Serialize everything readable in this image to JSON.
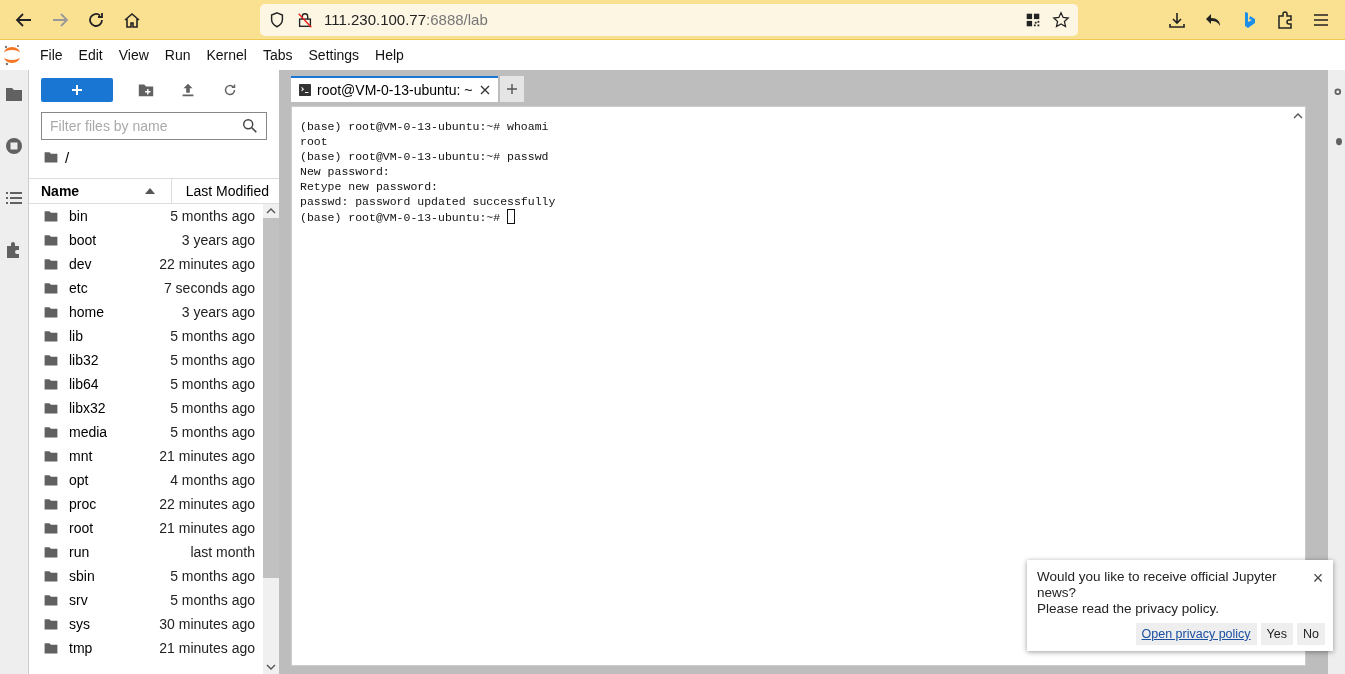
{
  "browser": {
    "url_host": "111.230.100.77",
    "url_path": ":6888/lab"
  },
  "menu": [
    "File",
    "Edit",
    "View",
    "Run",
    "Kernel",
    "Tabs",
    "Settings",
    "Help"
  ],
  "file_browser": {
    "filter_placeholder": "Filter files by name",
    "path": "/",
    "columns": [
      "Name",
      "Last Modified"
    ],
    "files": [
      {
        "name": "bin",
        "modified": "5 months ago"
      },
      {
        "name": "boot",
        "modified": "3 years ago"
      },
      {
        "name": "dev",
        "modified": "22 minutes ago"
      },
      {
        "name": "etc",
        "modified": "7 seconds ago"
      },
      {
        "name": "home",
        "modified": "3 years ago"
      },
      {
        "name": "lib",
        "modified": "5 months ago"
      },
      {
        "name": "lib32",
        "modified": "5 months ago"
      },
      {
        "name": "lib64",
        "modified": "5 months ago"
      },
      {
        "name": "libx32",
        "modified": "5 months ago"
      },
      {
        "name": "media",
        "modified": "5 months ago"
      },
      {
        "name": "mnt",
        "modified": "21 minutes ago"
      },
      {
        "name": "opt",
        "modified": "4 months ago"
      },
      {
        "name": "proc",
        "modified": "22 minutes ago"
      },
      {
        "name": "root",
        "modified": "21 minutes ago"
      },
      {
        "name": "run",
        "modified": "last month"
      },
      {
        "name": "sbin",
        "modified": "5 months ago"
      },
      {
        "name": "srv",
        "modified": "5 months ago"
      },
      {
        "name": "sys",
        "modified": "30 minutes ago"
      },
      {
        "name": "tmp",
        "modified": "21 minutes ago"
      }
    ]
  },
  "tabs": [
    {
      "label": "root@VM-0-13-ubuntu: ~",
      "selected": true
    }
  ],
  "terminal": {
    "cursor": true,
    "lines": [
      "(base) root@VM-0-13-ubuntu:~# whoami",
      "root",
      "(base) root@VM-0-13-ubuntu:~# passwd",
      "New password:",
      "Retype new password:",
      "passwd: password updated successfully",
      "(base) root@VM-0-13-ubuntu:~# "
    ]
  },
  "notification": {
    "message": "Would you like to receive official Jupyter news?",
    "note": "Please read the privacy policy.",
    "link": "Open privacy policy",
    "buttons": [
      "Yes",
      "No"
    ],
    "close": "×"
  }
}
